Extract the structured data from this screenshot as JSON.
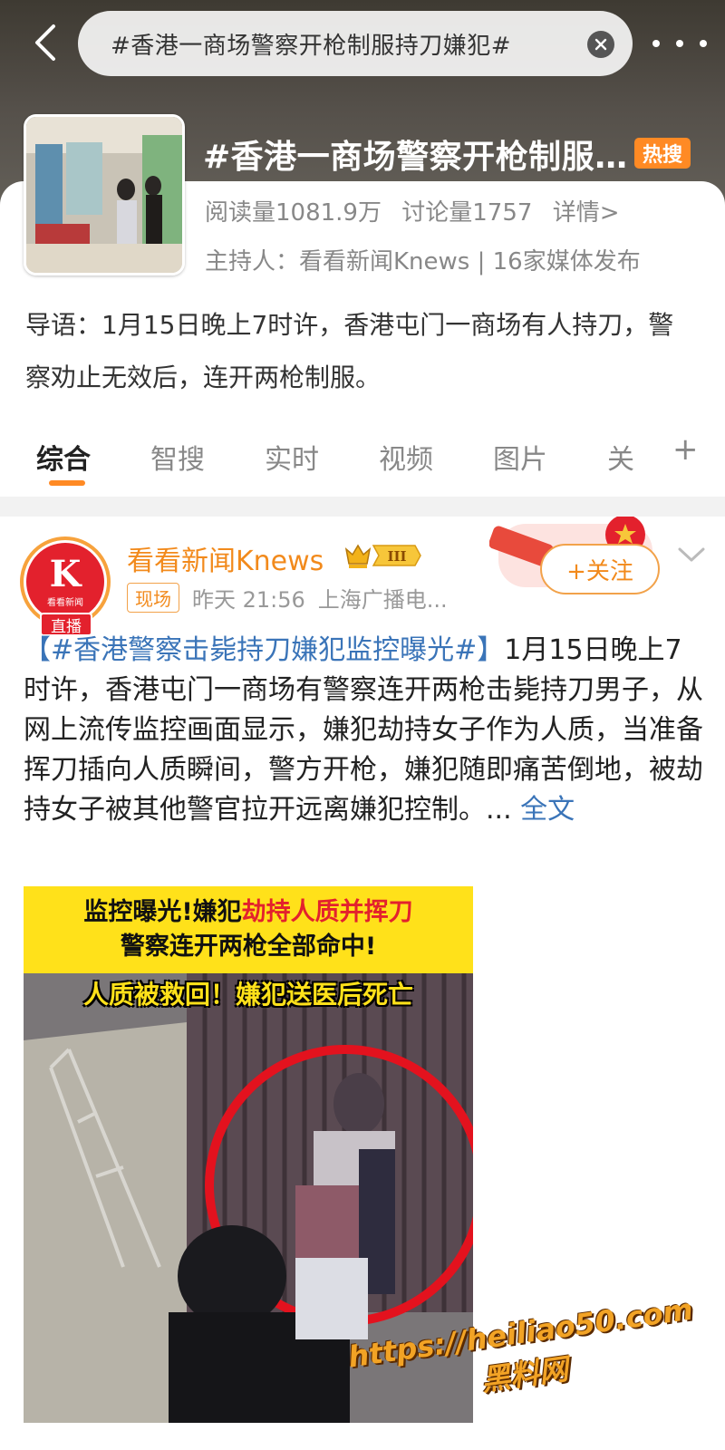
{
  "search": {
    "query": "#香港一商场警察开枪制服持刀嫌犯#"
  },
  "topic": {
    "title": "#香港一商场警察开枪制服持刀嫌犯#",
    "hot_badge": "热搜",
    "reads": "阅读量1081.9万",
    "discussions": "讨论量1757",
    "details_link": "详情>",
    "host": "主持人：看看新闻Knews | 16家媒体发布",
    "intro": "导语：1月15日晚上7时许，香港屯门一商场有人持刀，警察劝止无效后，连开两枪制服。"
  },
  "tabs": [
    {
      "label": "综合",
      "active": true
    },
    {
      "label": "智搜"
    },
    {
      "label": "实时"
    },
    {
      "label": "视频"
    },
    {
      "label": "图片"
    },
    {
      "label": "关"
    }
  ],
  "tabs_plus": "+",
  "post": {
    "author": "看看新闻Knews",
    "vip_level": "III",
    "avatar_letter": "K",
    "avatar_sub": "看看新闻",
    "live_tag": "直播",
    "scene_tag": "现场",
    "time": "昨天 21:56",
    "source": "上海广播电...",
    "follow_label": "+关注",
    "hashtag": "【#香港警察击毙持刀嫌犯监控曝光#】",
    "body": "1月15日晚上7时许，香港屯门一商场有警察连开两枪击毙持刀男子，从网上流传监控画面显示，嫌犯劫持女子作为人质，当准备挥刀插向人质瞬间，警方开枪，嫌犯随即痛苦倒地，被劫持女子被其他警官拉开远离嫌犯控制。...",
    "full_text": "全文",
    "image": {
      "line1_black": "监控曝光!嫌犯",
      "line1_red": "劫持人质并挥刀",
      "line2": "警察连开两枪全部命中!",
      "line3": "人质被救回！嫌犯送医后死亡"
    }
  },
  "watermark": {
    "url": "https://heiliao50.com",
    "name": "黑料网"
  },
  "colors": {
    "accent": "#ff8a24",
    "link": "#3a74b8",
    "brand_red": "#e3212d",
    "banner_yellow": "#ffe11a"
  }
}
